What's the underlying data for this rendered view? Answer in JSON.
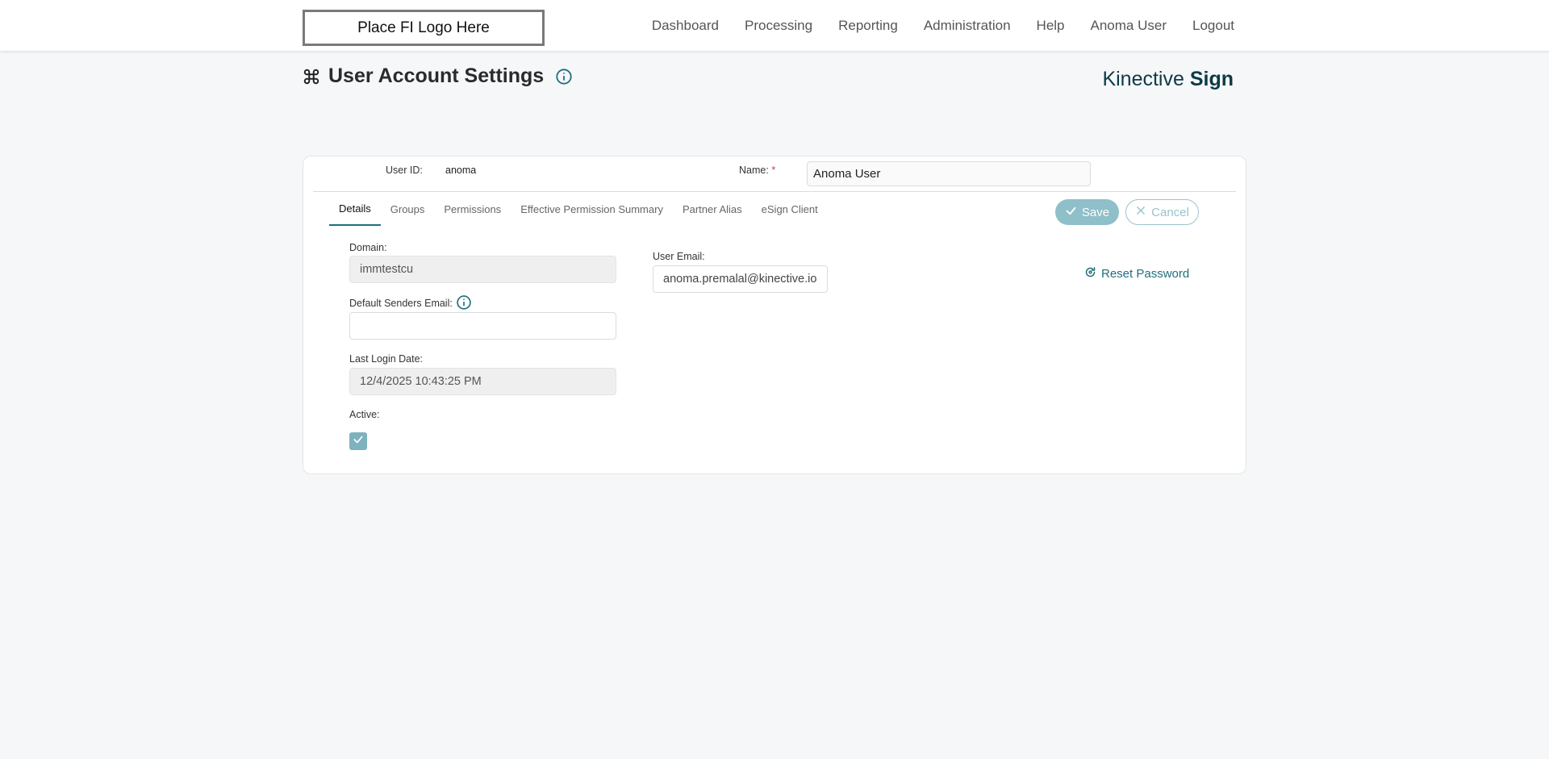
{
  "header": {
    "logo_text": "Place FI Logo Here",
    "nav": [
      "Dashboard",
      "Processing",
      "Reporting",
      "Administration",
      "Help",
      "Anoma User",
      "Logout"
    ]
  },
  "page": {
    "title": "User Account Settings",
    "brand_light": "Kinective ",
    "brand_bold": "Sign"
  },
  "user": {
    "user_id_label": "User ID:",
    "user_id": "anoma",
    "name_label": "Name:",
    "name_required": "*",
    "name_value": "Anoma User"
  },
  "tabs": [
    "Details",
    "Groups",
    "Permissions",
    "Effective Permission Summary",
    "Partner Alias",
    "eSign Client"
  ],
  "actions": {
    "save": "Save",
    "cancel": "Cancel",
    "reset_password": "Reset Password"
  },
  "details": {
    "domain_label": "Domain:",
    "domain_value": "immtestcu",
    "default_senders_email_label": "Default Senders Email:",
    "default_senders_email_value": "",
    "last_login_label": "Last Login Date:",
    "last_login_value": "12/4/2025 10:43:25 PM",
    "active_label": "Active:",
    "active_checked": true,
    "user_email_label": "User Email:",
    "user_email_value": "anoma.premalal@kinective.io"
  },
  "colors": {
    "accent": "#1f6f7e",
    "save_button": "#8fbfc8",
    "checkbox": "#7eb2bd",
    "brand": "#0c3b45",
    "required": "#d43a3a"
  }
}
